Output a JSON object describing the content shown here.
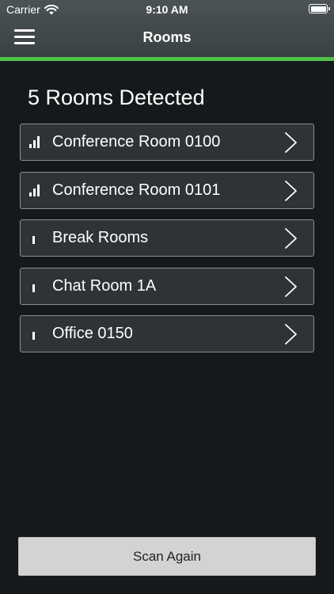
{
  "status_bar": {
    "carrier": "Carrier",
    "time": "9:10 AM"
  },
  "nav": {
    "title": "Rooms"
  },
  "main": {
    "heading": "5 Rooms Detected",
    "rooms": [
      {
        "name": "Conference Room 0100",
        "signal_bars": 3
      },
      {
        "name": "Conference Room 0101",
        "signal_bars": 3
      },
      {
        "name": "Break Rooms",
        "signal_bars": 1
      },
      {
        "name": "Chat Room 1A",
        "signal_bars": 1
      },
      {
        "name": "Office 0150",
        "signal_bars": 1
      }
    ]
  },
  "footer": {
    "scan_button_label": "Scan Again"
  },
  "colors": {
    "accent": "#4fc24a",
    "background": "#141a1b",
    "row_background": "#2e3335",
    "button_background": "#d3d3d3"
  }
}
